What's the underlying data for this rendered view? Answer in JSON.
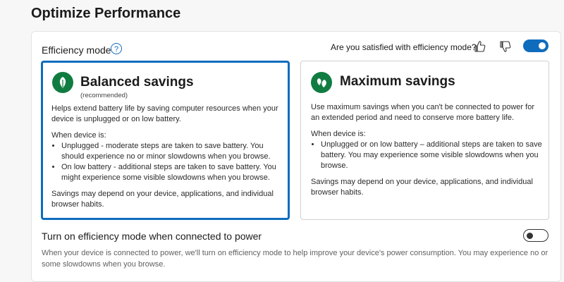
{
  "page": {
    "title": "Optimize Performance"
  },
  "efficiency": {
    "label": "Efficiency mode",
    "help_icon": "question-circle-icon",
    "feedback_prompt": "Are you satisfied with efficiency mode?",
    "toggle_on": true,
    "accent": "#0f6cbd"
  },
  "cards": {
    "balanced": {
      "title": "Balanced savings",
      "subtitle": "(recommended)",
      "selected": true,
      "description": "Helps extend battery life by saving computer resources when your device is unplugged or on low battery.",
      "when_label": "When device is:",
      "bullets": [
        "Unplugged - moderate steps are taken to save battery. You should experience no or minor slowdowns when you browse.",
        "On low battery - additional steps are taken to save battery. You might experience some visible slowdowns when you browse."
      ],
      "footer": "Savings may depend on your device, applications, and individual browser habits."
    },
    "maximum": {
      "title": "Maximum savings",
      "description": "Use maximum savings when you can't be connected to power for an extended period and need to conserve more battery life.",
      "when_label": "When device is:",
      "bullets": [
        "Unplugged or on low battery – additional steps are taken to save battery. You may experience some visible slowdowns when you browse."
      ],
      "footer": "Savings may depend on your device, applications, and individual browser habits."
    }
  },
  "power": {
    "title": "Turn on efficiency mode when connected to power",
    "description": "When your device is connected to power, we'll turn on efficiency mode to help improve your device's power consumption. You may experience no or some slowdowns when you browse.",
    "toggle_on": false
  }
}
